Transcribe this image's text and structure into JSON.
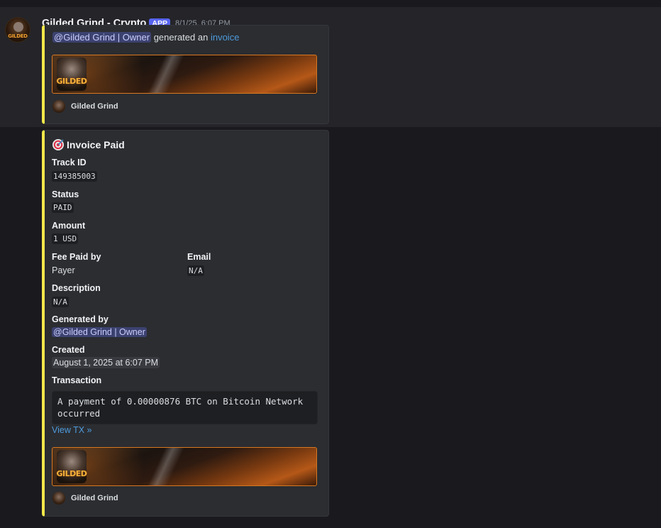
{
  "message": {
    "author": "Gilded Grind - Crypto",
    "badge": "APP",
    "timestamp": "8/1/25, 6:07 PM",
    "avatar_icon": "gilded-grind-logo",
    "avatar_text": "GILDED"
  },
  "embed1": {
    "mention": "@Gilded Grind | Owner",
    "middle": "generated an",
    "link": "invoice",
    "banner_text": "GILDED",
    "footer": "Gilded Grind",
    "accent_color": "#f2e84a"
  },
  "embed2": {
    "title_icon": "target-icon",
    "title": "Invoice Paid",
    "fields": {
      "track_id": {
        "name": "Track ID",
        "value": "149385003"
      },
      "status": {
        "name": "Status",
        "value": "PAID"
      },
      "amount": {
        "name": "Amount",
        "value": "1 USD"
      },
      "fee": {
        "name": "Fee Paid by",
        "value": "Payer"
      },
      "email": {
        "name": "Email",
        "value": "N/A"
      },
      "description": {
        "name": "Description",
        "value": "N/A"
      },
      "generated": {
        "name": "Generated by",
        "value": "@Gilded Grind | Owner"
      },
      "created": {
        "name": "Created",
        "value": "August 1, 2025 at 6:07 PM"
      },
      "transaction": {
        "name": "Transaction",
        "value": "A payment of 0.00000876 BTC on Bitcoin Network occurred"
      }
    },
    "view_tx": "View TX »",
    "banner_text": "GILDED",
    "footer": "Gilded Grind",
    "accent_color": "#f2e84a"
  }
}
